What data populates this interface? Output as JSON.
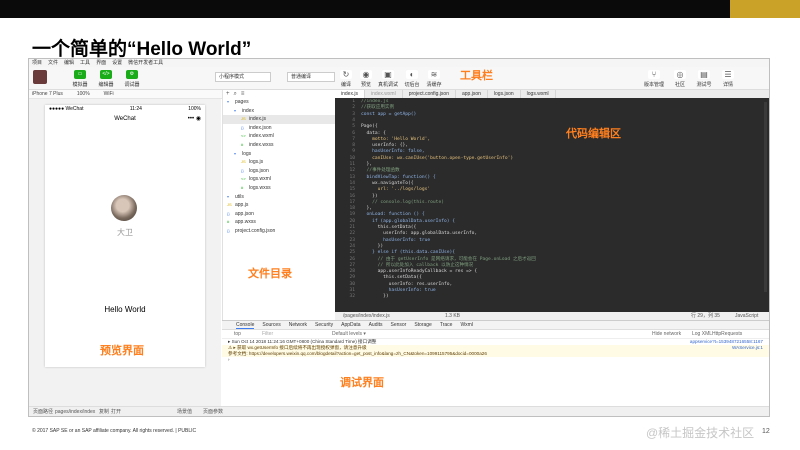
{
  "slide": {
    "title": "一个简单的“Hello World”",
    "footer": "© 2017 SAP SE or an SAP affiliate company. All rights reserved.  |  PUBLIC",
    "page": "12",
    "watermark": "@稀土掘金技术社区",
    "colors": {
      "top_band": "#0a0a0a",
      "gold_band": "#c9a227",
      "annotation": "#ff7f1e",
      "wechat_green": "#1aad19"
    }
  },
  "annotations": {
    "toolbar": "工具栏",
    "code_editor": "代码编辑区",
    "file_dir": "文件目录",
    "preview": "预览界面",
    "debugger": "调试界面"
  },
  "menubar": [
    "项目",
    "文件",
    "编辑",
    "工具",
    "界面",
    "设置",
    "微信开发者工具"
  ],
  "toolbar": {
    "buttons": [
      {
        "label": "模拟器",
        "icon": "simulator-icon"
      },
      {
        "label": "编辑器",
        "icon": "editor-icon"
      },
      {
        "label": "调试器",
        "icon": "debugger-icon"
      }
    ],
    "mode_select": "小程序模式",
    "compile_select": "普通编译",
    "actions": [
      "编译",
      "预览",
      "真机调试",
      "切后台",
      "清缓存"
    ],
    "right_actions": [
      "版本管理",
      "社区",
      "测试号",
      "详情"
    ]
  },
  "simulator": {
    "device": "iPhone 7 Plus",
    "zoom": "100%",
    "network": "WiFi",
    "status_left": "●●●●● WeChat",
    "status_time": "11:24",
    "status_right": "100%",
    "nav_title": "WeChat",
    "capsule": "••• ◉",
    "nickname": "大卫",
    "hello_text": "Hello World"
  },
  "files": [
    {
      "name": "pages",
      "indent": 0,
      "type": "folder"
    },
    {
      "name": "index",
      "indent": 1,
      "type": "folder"
    },
    {
      "name": "index.js",
      "indent": 2,
      "type": "js",
      "selected": true
    },
    {
      "name": "index.json",
      "indent": 2,
      "type": "json"
    },
    {
      "name": "index.wxml",
      "indent": 2,
      "type": "wxml"
    },
    {
      "name": "index.wxss",
      "indent": 2,
      "type": "wxss"
    },
    {
      "name": "logs",
      "indent": 1,
      "type": "folder"
    },
    {
      "name": "logs.js",
      "indent": 2,
      "type": "js"
    },
    {
      "name": "logs.json",
      "indent": 2,
      "type": "json"
    },
    {
      "name": "logs.wxml",
      "indent": 2,
      "type": "wxml"
    },
    {
      "name": "logs.wxss",
      "indent": 2,
      "type": "wxss"
    },
    {
      "name": "utils",
      "indent": 0,
      "type": "folder"
    },
    {
      "name": "app.js",
      "indent": 0,
      "type": "js"
    },
    {
      "name": "app.json",
      "indent": 0,
      "type": "json"
    },
    {
      "name": "app.wxss",
      "indent": 0,
      "type": "wxss"
    },
    {
      "name": "project.config.json",
      "indent": 0,
      "type": "json"
    }
  ],
  "editor": {
    "tabs": [
      "index.js",
      "index.wxml",
      "project.config.json",
      "app.json",
      "logs.json",
      "logs.wxml"
    ],
    "active_tab": 0,
    "code_lines": [
      "//index.js",
      "//获取应用实例",
      "const app = getApp()",
      "",
      "Page({",
      "  data: {",
      "    motto: 'Hello World',",
      "    userInfo: {},",
      "    hasUserInfo: false,",
      "    canIUse: wx.canIUse('button.open-type.getUserInfo')",
      "  },",
      "  //事件处理函数",
      "  bindViewTap: function() {",
      "    wx.navigateTo({",
      "      url: '../logs/logs'",
      "    })",
      "    // console.log(this.route)",
      "  },",
      "  onLoad: function () {",
      "    if (app.globalData.userInfo) {",
      "      this.setData({",
      "        userInfo: app.globalData.userInfo,",
      "        hasUserInfo: true",
      "      })",
      "    } else if (this.data.canIUse){",
      "      // 由于 getUserInfo 是网络请求，可能会在 Page.onLoad 之后才返回",
      "      // 所以此处加入 callback 以防止这种情况",
      "      app.userInfoReadyCallback = res => {",
      "        this.setData({",
      "          userInfo: res.userInfo,",
      "          hasUserInfo: true",
      "        })",
      "      }"
    ],
    "file_path": "/pages/index/index.js",
    "file_size": "1.3 KB",
    "cursor": "行 29，列 35",
    "language": "JavaScript"
  },
  "debugger": {
    "tabs": [
      "Console",
      "Sources",
      "Network",
      "Security",
      "AppData",
      "Audits",
      "Sensor",
      "Storage",
      "Trace",
      "Wxml"
    ],
    "context": "top",
    "filter": "Filter",
    "levels": "Default levels ▾",
    "hide_network": "Hide network",
    "log_xmlhttp": "Log XMLHttpRequests",
    "lines": [
      {
        "text": "▸ Sun Oct 14 2018 11:24:16 GMT+0800 (China Standard Time) 接口调整",
        "source": "appservice?t=1539487216558:1167",
        "warn": false
      },
      {
        "text": "⚠ ▸ 获取 wx.getUserInfo 接口后续将不再出现授权弹窗，请注意升级",
        "source": "WAService.js:1",
        "warn": true
      },
      {
        "text": "   参考文档: https://developers.weixin.qq.com/blogdetail?action=get_post_info&lang=zh_CN&token=1099115795&docid=0000a26",
        "source": "",
        "warn": true
      },
      {
        "text": "›",
        "source": "",
        "warn": false
      }
    ]
  },
  "statusbar": {
    "path_label": "页面路径",
    "path": "pages/index/index",
    "copy": "复制",
    "open": "打开",
    "scene": "场景值",
    "params": "页面参数"
  }
}
